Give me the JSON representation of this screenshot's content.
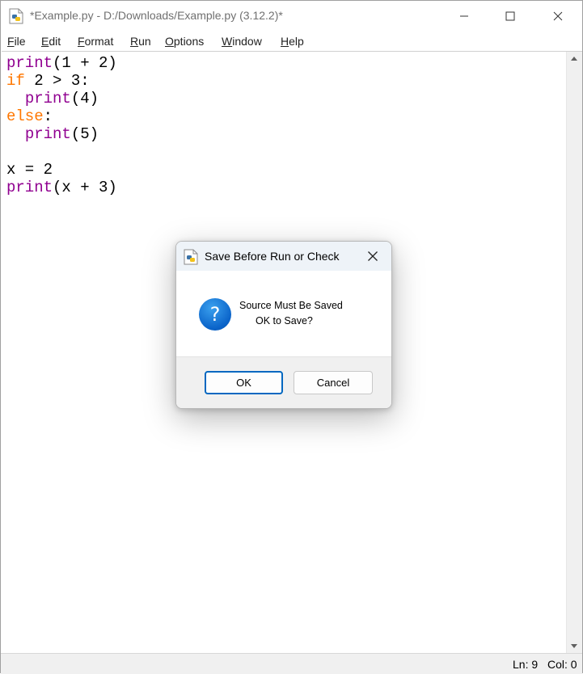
{
  "window": {
    "title": "*Example.py - D:/Downloads/Example.py (3.12.2)*"
  },
  "menu": {
    "items": [
      {
        "first": "F",
        "rest": "ile"
      },
      {
        "first": "E",
        "rest": "dit"
      },
      {
        "first": "F",
        "rest": "ormat"
      },
      {
        "first": "R",
        "rest": "un"
      },
      {
        "first": "O",
        "rest": "ptions"
      },
      {
        "first": "W",
        "rest": "indow"
      },
      {
        "first": "H",
        "rest": "elp"
      }
    ]
  },
  "editor": {
    "lines": [
      [
        {
          "t": "print",
          "c": "bi"
        },
        {
          "t": "(1 + 2)",
          "c": ""
        }
      ],
      [
        {
          "t": "if",
          "c": "kw"
        },
        {
          "t": " 2 > 3:",
          "c": ""
        }
      ],
      [
        {
          "t": "  ",
          "c": ""
        },
        {
          "t": "print",
          "c": "bi"
        },
        {
          "t": "(4)",
          "c": ""
        }
      ],
      [
        {
          "t": "else",
          "c": "kw"
        },
        {
          "t": ":",
          "c": ""
        }
      ],
      [
        {
          "t": "  ",
          "c": ""
        },
        {
          "t": "print",
          "c": "bi"
        },
        {
          "t": "(5)",
          "c": ""
        }
      ],
      [],
      [
        {
          "t": "x = 2",
          "c": ""
        }
      ],
      [
        {
          "t": "print",
          "c": "bi"
        },
        {
          "t": "(x + 3)",
          "c": ""
        }
      ]
    ]
  },
  "status": {
    "ln": "Ln: 9",
    "col": "Col: 0"
  },
  "dialog": {
    "title": "Save Before Run or Check",
    "message_line1": "Source Must Be Saved",
    "message_line2": "OK to Save?",
    "ok_label": "OK",
    "cancel_label": "Cancel",
    "icon": "question-icon"
  },
  "colors": {
    "keyword": "#ff7700",
    "builtin": "#900090",
    "dialog_accent": "#0067c0"
  }
}
